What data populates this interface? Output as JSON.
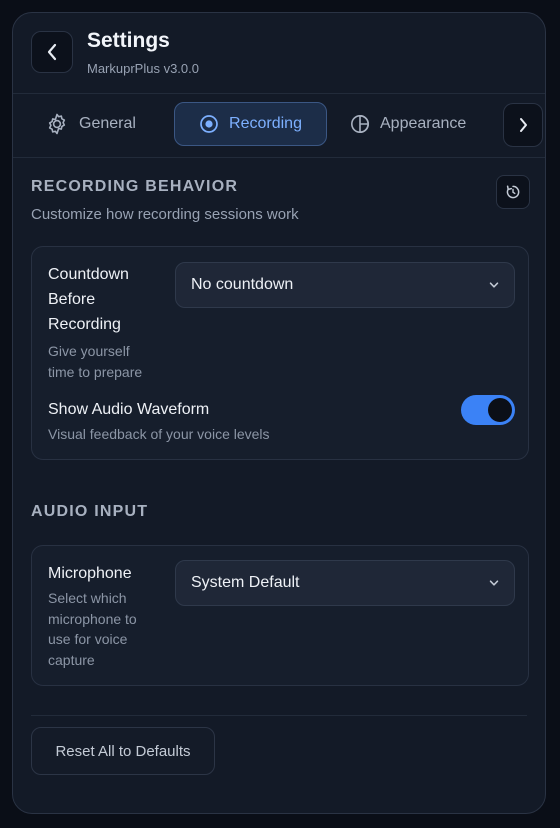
{
  "header": {
    "title": "Settings",
    "subtitle": "MarkuprPlus v3.0.0"
  },
  "tabs": [
    {
      "label": "General",
      "icon": "gear-icon"
    },
    {
      "label": "Recording",
      "icon": "record-icon",
      "active": true
    },
    {
      "label": "Appearance",
      "icon": "contrast-icon"
    }
  ],
  "recording_behavior": {
    "title": "RECORDING BEHAVIOR",
    "description": "Customize how recording sessions work",
    "countdown": {
      "label_lines": [
        "Countdown",
        "Before",
        "Recording"
      ],
      "help_lines": [
        "Give yourself",
        "time to prepare"
      ],
      "value": "No countdown"
    },
    "waveform": {
      "label": "Show Audio Waveform",
      "help": "Visual feedback of your voice levels",
      "enabled": true
    }
  },
  "audio_input": {
    "title": "AUDIO INPUT",
    "microphone": {
      "label": "Microphone",
      "help_lines": [
        "Select which",
        "microphone to",
        "use for voice",
        "capture"
      ],
      "value": "System Default"
    }
  },
  "footer": {
    "reset_all_label": "Reset All to Defaults"
  },
  "colors": {
    "accent": "#3b82f6",
    "active_tab_text": "#7db0ff",
    "background": "#131a27"
  }
}
